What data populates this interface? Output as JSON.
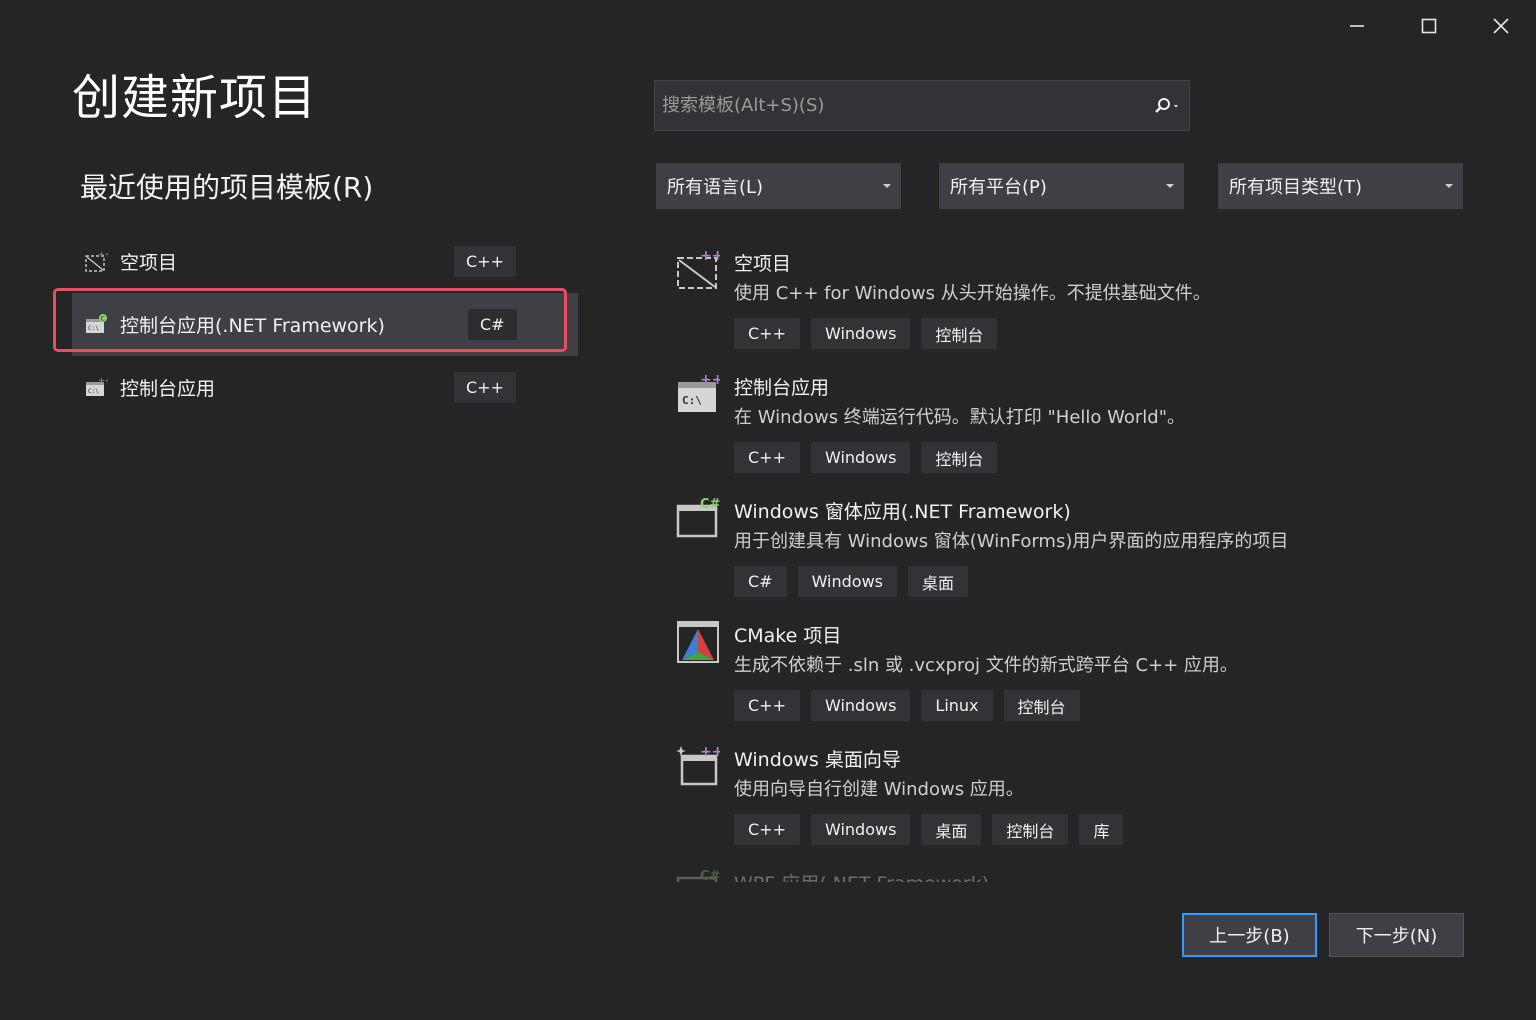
{
  "window": {
    "title": "创建新项目",
    "controls": [
      "minimize",
      "maximize",
      "close"
    ]
  },
  "recent": {
    "heading": "最近使用的项目模板(R)",
    "items": [
      {
        "label": "空项目",
        "lang": "C++",
        "icon": "empty-project-icon"
      },
      {
        "label": "控制台应用(.NET Framework)",
        "lang": "C#",
        "icon": "console-csharp-icon",
        "selected": true
      },
      {
        "label": "控制台应用",
        "lang": "C++",
        "icon": "console-cpp-icon"
      }
    ]
  },
  "search": {
    "placeholder": "搜索模板(Alt+S)(S)",
    "value": ""
  },
  "filters": {
    "language": "所有语言(L)",
    "platform": "所有平台(P)",
    "project_type": "所有项目类型(T)"
  },
  "templates": [
    {
      "name": "空项目",
      "description": "使用 C++ for Windows 从头开始操作。不提供基础文件。",
      "tags": [
        "C++",
        "Windows",
        "控制台"
      ],
      "icon": "empty-project-icon"
    },
    {
      "name": "控制台应用",
      "description": "在 Windows 终端运行代码。默认打印 \"Hello World\"。",
      "tags": [
        "C++",
        "Windows",
        "控制台"
      ],
      "icon": "console-app-icon"
    },
    {
      "name": "Windows 窗体应用(.NET Framework)",
      "description": "用于创建具有 Windows 窗体(WinForms)用户界面的应用程序的项目",
      "tags": [
        "C#",
        "Windows",
        "桌面"
      ],
      "icon": "winforms-icon"
    },
    {
      "name": "CMake 项目",
      "description": "生成不依赖于 .sln 或 .vcxproj 文件的新式跨平台 C++ 应用。",
      "tags": [
        "C++",
        "Windows",
        "Linux",
        "控制台"
      ],
      "icon": "cmake-icon"
    },
    {
      "name": "Windows 桌面向导",
      "description": "使用向导自行创建 Windows 应用。",
      "tags": [
        "C++",
        "Windows",
        "桌面",
        "控制台",
        "库"
      ],
      "icon": "desktop-wizard-icon"
    },
    {
      "name": "WPF 应用(.NET Framework)",
      "description": "",
      "tags": [],
      "icon": "wpf-icon"
    }
  ],
  "buttons": {
    "back": "上一步(B)",
    "next": "下一步(N)"
  },
  "colors": {
    "background": "#252526",
    "selection": "#3f3f46",
    "highlight_border": "#e85060",
    "focus_border": "#3399ff",
    "cpp_accent": "#b180d7",
    "csharp_accent": "#8ed16f"
  }
}
